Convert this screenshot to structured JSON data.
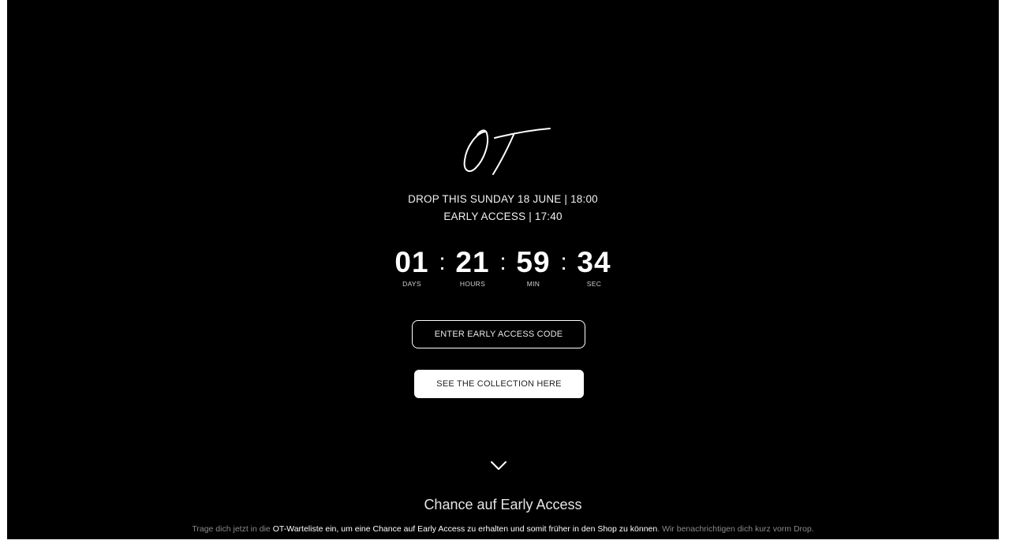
{
  "header": {
    "logo_icon": "ot-signature-logo",
    "drop_line": "DROP THIS SUNDAY 18 JUNE | 18:00",
    "early_access_line": "EARLY ACCESS | 17:40"
  },
  "countdown": {
    "days": "01",
    "hours": "21",
    "min": "59",
    "sec": "34",
    "separator": ":",
    "labels": {
      "days": "DAYS",
      "hours": "HOURS",
      "min": "MIN",
      "sec": "SEC"
    }
  },
  "actions": {
    "early_access_code_label": "ENTER EARLY ACCESS CODE",
    "see_collection_label": "SEE THE COLLECTION HERE"
  },
  "scroll_icon": "chevron-down-icon",
  "early_access_section": {
    "title": "Chance auf Early Access",
    "text_before": "Trage dich jetzt in die ",
    "text_highlight": "OT-Warteliste ein, um eine Chance auf Early Access zu erhalten und somit früher in den Shop zu können",
    "text_after": ". Wir benachrichtigen dich kurz vorm Drop."
  },
  "colors": {
    "background": "#000000",
    "text": "#ffffff",
    "muted_text": "#8a8a8a",
    "button_solid_bg": "#ffffff",
    "button_solid_text": "#222222"
  }
}
